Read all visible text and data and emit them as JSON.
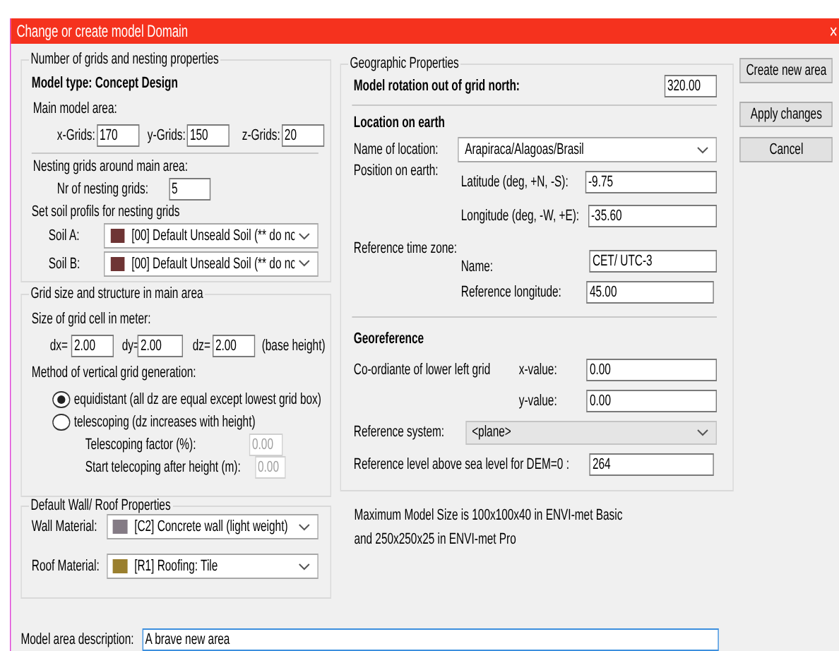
{
  "window": {
    "title": "Change or create model Domain",
    "close_icon": "×"
  },
  "grids": {
    "legend": "Number of grids and nesting properties",
    "model_type": "Model type: Concept Design",
    "main_area_label": "Main model area:",
    "grid_fields": [
      {
        "label": "x-Grids:",
        "value": "170"
      },
      {
        "label": "y-Grids:",
        "value": "150"
      },
      {
        "label": "z-Grids:",
        "value": "20"
      }
    ],
    "nesting_label": "Nesting grids around main area:",
    "nesting_field": {
      "label": "Nr of nesting grids:",
      "value": "5"
    },
    "soil_label": "Set soil profils for nesting grids",
    "soils": [
      {
        "label": "Soil A:",
        "value": "[00] Default Unseald Soil (** do nc",
        "color": "#6e3434"
      },
      {
        "label": "Soil B:",
        "value": "[00] Default Unseald Soil (** do nc",
        "color": "#6e3434"
      }
    ]
  },
  "cell": {
    "legend": "Grid size and structure in main area",
    "size_label": "Size of grid cell in meter:",
    "sizes": [
      {
        "label": "dx=",
        "value": "2.00"
      },
      {
        "label": "dy=",
        "value": "2.00"
      },
      {
        "label": "dz=",
        "value": "2.00"
      }
    ],
    "size_note": "(base height)",
    "method_label": "Method of vertical grid generation:",
    "methods": [
      {
        "label": "equidistant (all dz are equal except lowest grid box)",
        "selected": true
      },
      {
        "label": "telescoping (dz increases with height)",
        "selected": false
      }
    ],
    "telescoping_fields": [
      {
        "label": "Telescoping factor (%):",
        "value": "0.00",
        "disabled": true
      },
      {
        "label": "Start telecoping after height (m):",
        "value": "0.00",
        "disabled": true
      }
    ]
  },
  "materials": {
    "legend": "Default Wall/ Roof Properties",
    "items": [
      {
        "label": "Wall Material:",
        "value": "[C2] Concrete wall (light weight)",
        "color": "#847b85"
      },
      {
        "label": "Roof Material:",
        "value": "[R1] Roofing: Tile",
        "color": "#9a7f2e"
      }
    ]
  },
  "geo": {
    "legend": "Geographic Properties",
    "rotation": {
      "label": "Model rotation out of grid north:",
      "value": "320.00"
    },
    "location_heading": "Location on earth",
    "location": {
      "label": "Name of location:",
      "value": "Arapiraca/Alagoas/Brasil",
      "editable": true
    },
    "position_label": "Position on earth:",
    "position_fields": [
      {
        "label": "Latitude (deg, +N, -S):",
        "value": "-9.75"
      },
      {
        "label": "Longitude (deg, -W, +E):",
        "value": "-35.60"
      }
    ],
    "timezone_label": "Reference time zone:",
    "timezone_fields": [
      {
        "label": "Name:",
        "value": "CET/ UTC-3"
      },
      {
        "label": "Reference longitude:",
        "value": "45.00"
      }
    ],
    "georef_heading": "Georeference",
    "coord_label": "Co-ordiante of lower left grid",
    "coord_fields": [
      {
        "label": "x-value:",
        "value": "0.00"
      },
      {
        "label": "y-value:",
        "value": "0.00"
      }
    ],
    "ref_system": {
      "label": "Reference system:",
      "value": "<plane>",
      "editable": false
    },
    "dem": {
      "label": "Reference level above sea level for DEM=0 :",
      "value": "264"
    }
  },
  "notes": [
    "Maximum Model Size is 100x100x40 in ENVI-met Basic",
    "and 250x250x25 in ENVI-met Pro"
  ],
  "buttons": [
    "Create new area",
    "Apply changes",
    "Cancel"
  ],
  "description": {
    "label": "Model area description:",
    "value": "A brave new area",
    "focused": true
  }
}
